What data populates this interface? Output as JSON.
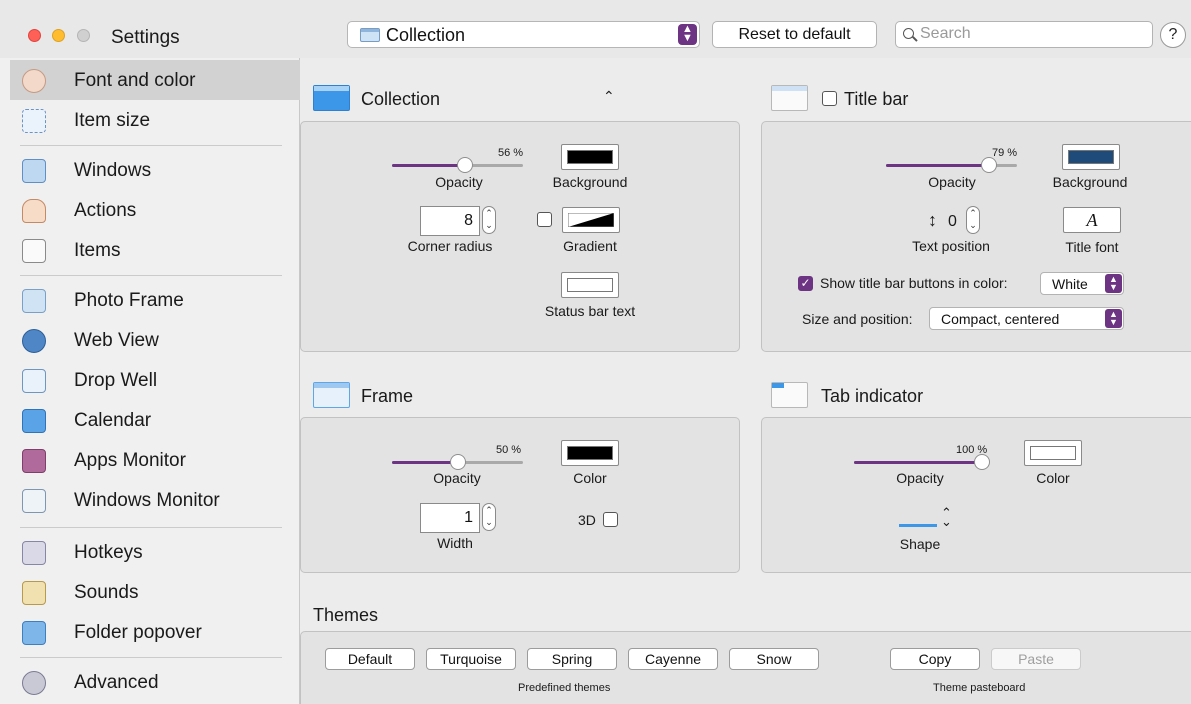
{
  "window": {
    "title": "Settings"
  },
  "toolbar": {
    "popup_label": "Collection",
    "reset_label": "Reset to default",
    "search_placeholder": "Search",
    "help_label": "?"
  },
  "sidebar": {
    "items": [
      {
        "label": "Font and color",
        "icon": "palette-icon",
        "selected": true
      },
      {
        "label": "Item size",
        "icon": "resize-icon"
      },
      {
        "label": "Windows",
        "icon": "windows-icon"
      },
      {
        "label": "Actions",
        "icon": "pointing-hand-icon"
      },
      {
        "label": "Items",
        "icon": "document-icon"
      },
      {
        "label": "Photo Frame",
        "icon": "photo-icon"
      },
      {
        "label": "Web View",
        "icon": "globe-icon"
      },
      {
        "label": "Drop Well",
        "icon": "drop-tray-icon"
      },
      {
        "label": "Calendar",
        "icon": "calendar-icon"
      },
      {
        "label": "Apps Monitor",
        "icon": "apps-list-icon"
      },
      {
        "label": "Windows Monitor",
        "icon": "windows-list-icon"
      },
      {
        "label": "Hotkeys",
        "icon": "alt-key-icon"
      },
      {
        "label": "Sounds",
        "icon": "speaker-icon"
      },
      {
        "label": "Folder popover",
        "icon": "folder-list-icon"
      },
      {
        "label": "Advanced",
        "icon": "gears-icon"
      }
    ]
  },
  "collection": {
    "header": "Collection",
    "opacity_pct": "56 %",
    "opacity_value": 0.56,
    "opacity_label": "Opacity",
    "background_label": "Background",
    "corner_radius_value": "8",
    "corner_radius_label": "Corner radius",
    "gradient_label": "Gradient",
    "status_bar_label": "Status bar text"
  },
  "title_bar": {
    "header": "Title bar",
    "opacity_pct": "79 %",
    "opacity_value": 0.79,
    "opacity_label": "Opacity",
    "background_label": "Background",
    "text_position_value": "0",
    "text_position_label": "Text position",
    "title_font_glyph": "A",
    "title_font_label": "Title font",
    "show_buttons_label": "Show title bar buttons in color:",
    "show_buttons_color": "White",
    "size_position_label": "Size and position:",
    "size_position_value": "Compact, centered"
  },
  "frame": {
    "header": "Frame",
    "opacity_pct": "50 %",
    "opacity_value": 0.5,
    "opacity_label": "Opacity",
    "color_label": "Color",
    "width_value": "1",
    "width_label": "Width",
    "three_d_label": "3D"
  },
  "tab_indicator": {
    "header": "Tab indicator",
    "opacity_pct": "100 %",
    "opacity_value": 1.0,
    "opacity_label": "Opacity",
    "color_label": "Color",
    "shape_label": "Shape"
  },
  "themes": {
    "header": "Themes",
    "predefined": [
      "Default",
      "Turquoise",
      "Spring",
      "Cayenne",
      "Snow"
    ],
    "predefined_caption": "Predefined themes",
    "copy_label": "Copy",
    "paste_label": "Paste",
    "pasteboard_caption": "Theme pasteboard"
  },
  "colors": {
    "accent": "#6c3483",
    "collection_bg": "#000000",
    "title_bar_bg": "#1f4b7a",
    "frame_color": "#000000",
    "tab_indicator_color": "#ffffff",
    "header_icon_blue": "#3d97e8"
  }
}
